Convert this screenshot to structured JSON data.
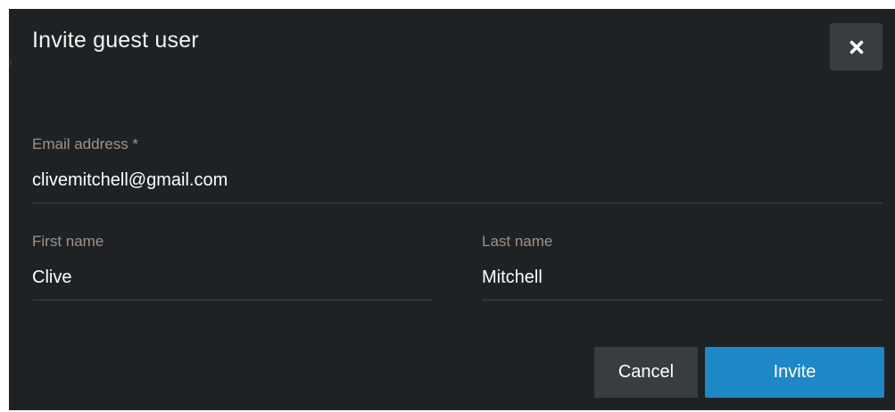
{
  "dialog": {
    "title": "Invite guest user",
    "close_icon": "close-icon",
    "colors": {
      "background": "#1e2224",
      "label": "#a29088",
      "primary": "#1e87c5",
      "secondary": "#3a3d3f"
    }
  },
  "form": {
    "email": {
      "label": "Email address *",
      "value": "clivemitchell@gmail.com"
    },
    "first_name": {
      "label": "First name",
      "value": "Clive"
    },
    "last_name": {
      "label": "Last name",
      "value": "Mitchell"
    }
  },
  "actions": {
    "cancel_label": "Cancel",
    "invite_label": "Invite"
  }
}
